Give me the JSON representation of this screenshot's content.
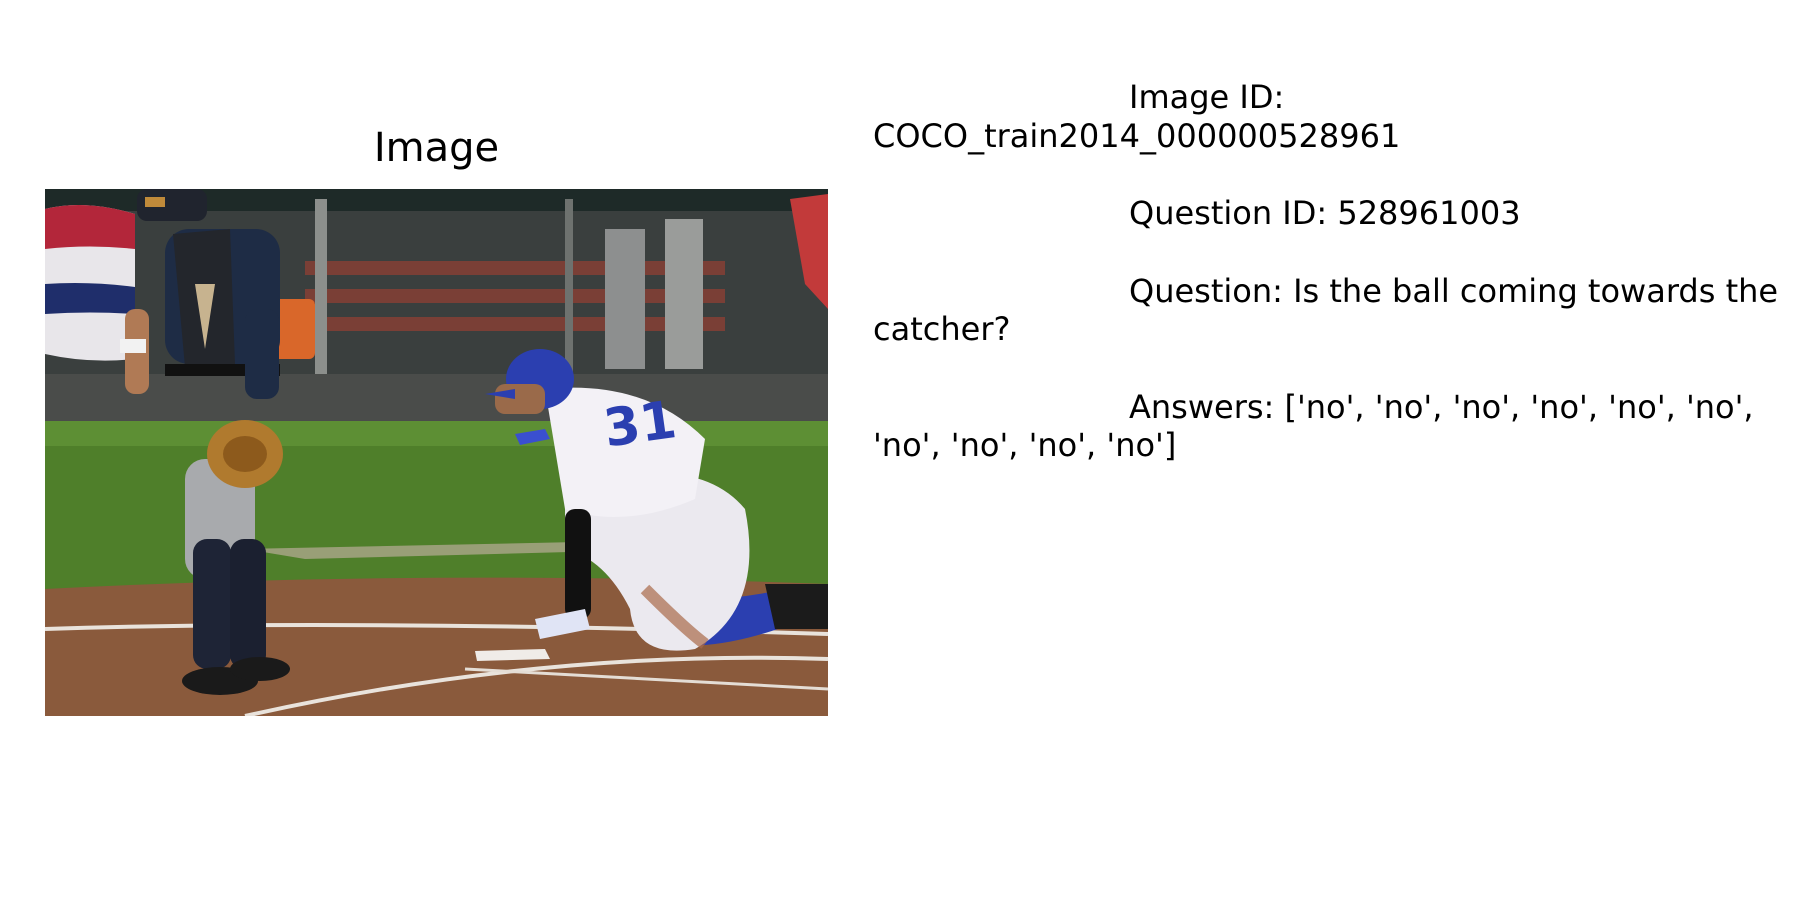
{
  "figure": {
    "image_title": "Image",
    "image_content": "baseball catcher standing at home plate while a runner in a white uniform with number 31 and blue helmet kneels after sliding"
  },
  "info": {
    "image_id": "Image ID: COCO_train2014_000000528961",
    "question_id": "Question ID: 528961003",
    "question": "Question: Is the ball coming towards the catcher?",
    "answers": "Answers: ['no', 'no', 'no', 'no', 'no', 'no', 'no', 'no', 'no', 'no']"
  },
  "colors": {
    "text": "#000000",
    "background": "#ffffff",
    "grass": "#4f7f2a",
    "dirt": "#8a5a3c",
    "uniform_blue": "#2b3fb0"
  }
}
